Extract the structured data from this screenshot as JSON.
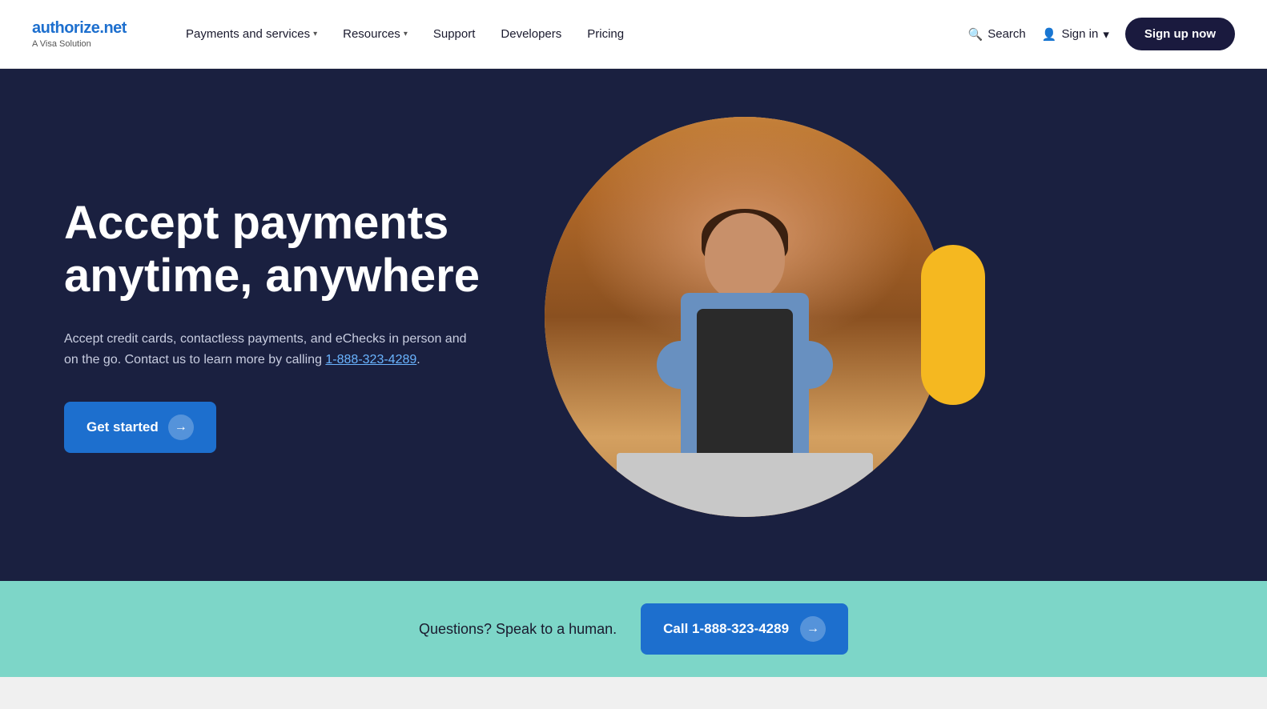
{
  "brand": {
    "name_part1": "authorize",
    "name_dot": ".",
    "name_part2": "net",
    "tagline": "A Visa Solution"
  },
  "nav": {
    "payments_label": "Payments and services",
    "resources_label": "Resources",
    "support_label": "Support",
    "developers_label": "Developers",
    "pricing_label": "Pricing",
    "search_label": "Search",
    "signin_label": "Sign in",
    "signup_label": "Sign up now"
  },
  "hero": {
    "title": "Accept payments anytime, anywhere",
    "description_prefix": "Accept credit cards, contactless payments, and eChecks in person and on the go. Contact us to learn more by calling ",
    "phone": "1-888-323-4289",
    "description_suffix": ".",
    "cta_label": "Get started",
    "arrow": "→"
  },
  "banner": {
    "text": "Questions? Speak to a human.",
    "cta_label": "Call 1-888-323-4289",
    "arrow": "→"
  }
}
